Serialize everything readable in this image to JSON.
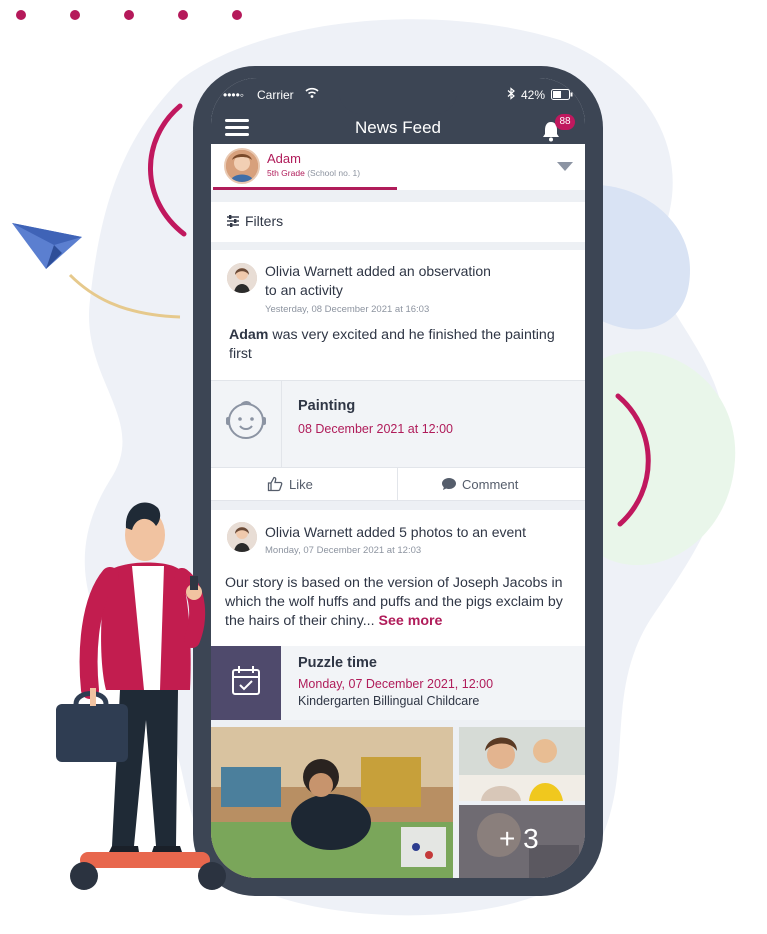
{
  "status_bar": {
    "carrier": "Carrier",
    "battery": "42%"
  },
  "header": {
    "title": "News Feed",
    "notification_count": "88"
  },
  "child_selector": {
    "name": "Adam",
    "grade": "5th Grade",
    "school": "(School no. 1)"
  },
  "filters": {
    "label": "Filters"
  },
  "posts": [
    {
      "author": "Olivia Warnett",
      "action_line1": "Olivia Warnett added an observation",
      "action_line2": "to an activity",
      "time": "Yesterday, 08 December 2021 at 16:03",
      "text_bold": "Adam",
      "text": " was very excited and he finished the painting first",
      "activity": {
        "title": "Painting",
        "date": "08 December 2021 at 12:00"
      },
      "actions": {
        "like": "Like",
        "comment": "Comment"
      }
    },
    {
      "author": "Olivia Warnett",
      "action": "Olivia Warnett added 5 photos to an event",
      "time": "Monday, 07 December 2021 at 12:03",
      "text": "Our story is based on the version of Joseph Jacobs in which the wolf huffs and puffs and the pigs exclaim by the hairs of their chiny...",
      "see_more": "See more",
      "event": {
        "title": "Puzzle time",
        "date": "Monday, 07 December 2021, 12:00",
        "place": "Kindergarten Billingual Childcare"
      },
      "photos_more": "+ 3"
    }
  ],
  "colors": {
    "accent": "#b01c5a",
    "phone": "#3c4554",
    "event_icon_bg": "#4f4a6c"
  }
}
